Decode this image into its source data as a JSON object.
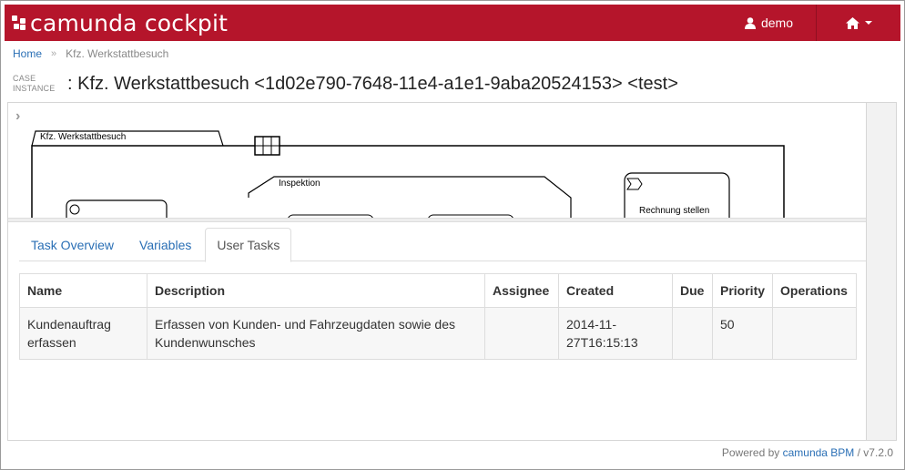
{
  "header": {
    "app_name": "camunda cockpit",
    "user": "demo",
    "brand_color": "#b5152b"
  },
  "breadcrumb": {
    "home": "Home",
    "separator": "»",
    "current": "Kfz. Werkstattbesuch"
  },
  "page": {
    "case_label_line1": "CASE",
    "case_label_line2": "INSTANCE",
    "title": ": Kfz. Werkstattbesuch <1d02e790-7648-11e4-a1e1-9aba20524153> <test>"
  },
  "diagram": {
    "case_plan": "Kfz. Werkstattbesuch",
    "stage": "Inspektion",
    "task": "Rechnung stellen"
  },
  "tabs": [
    {
      "label": "Task Overview",
      "active": false
    },
    {
      "label": "Variables",
      "active": false
    },
    {
      "label": "User Tasks",
      "active": true
    }
  ],
  "table": {
    "columns": [
      "Name",
      "Description",
      "Assignee",
      "Created",
      "Due",
      "Priority",
      "Operations"
    ],
    "rows": [
      {
        "name_line1": "Kundenauftrag",
        "name_line2": "erfassen",
        "description_line1": "Erfassen von Kunden- und Fahrzeugdaten sowie des",
        "description_line2": "Kundenwunsches",
        "assignee": "",
        "created_line1": "2014-11-",
        "created_line2": "27T16:15:13",
        "due": "",
        "priority": "50",
        "operations": ""
      }
    ]
  },
  "footer": {
    "prefix": "Powered by",
    "link": "camunda BPM",
    "version": "/ v7.2.0"
  }
}
